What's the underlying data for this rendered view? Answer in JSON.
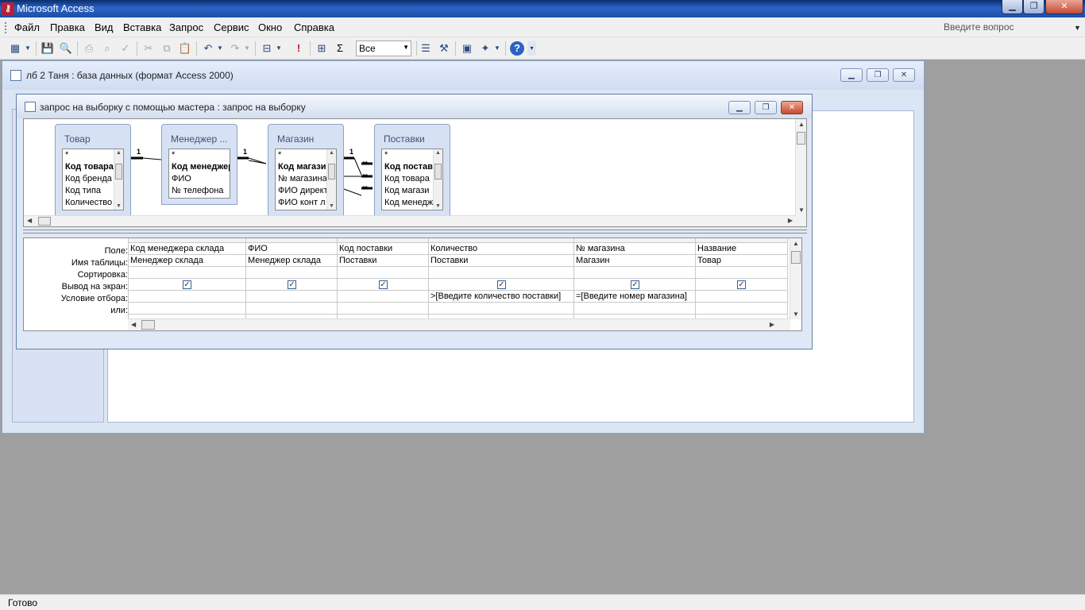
{
  "app": {
    "title": "Microsoft Access",
    "icon": "access-key-icon"
  },
  "menu": {
    "items": [
      "Файл",
      "Правка",
      "Вид",
      "Вставка",
      "Запрос",
      "Сервис",
      "Окно",
      "Справка"
    ],
    "ask_placeholder": "Введите вопрос"
  },
  "toolbar": {
    "top_values": "Все"
  },
  "db_window": {
    "title": "лб 2 Таня : база данных (формат Access 2000)"
  },
  "query_window": {
    "title": "запрос на выборку с помощью мастера : запрос на выборку"
  },
  "tables": [
    {
      "name": "Товар",
      "fields": [
        "*",
        "Код товара",
        "Код бренда",
        "Код типа",
        "Количество"
      ],
      "key_index": 1
    },
    {
      "name": "Менеджер ...",
      "fields": [
        "*",
        "Код менеджер",
        "ФИО",
        "№ телефона"
      ],
      "key_index": 1
    },
    {
      "name": "Магазин",
      "fields": [
        "*",
        "Код магазин",
        "№ магазина",
        "ФИО директ",
        "ФИО конт л"
      ],
      "key_index": 1
    },
    {
      "name": "Поставки",
      "fields": [
        "*",
        "Код постав",
        "Код товара",
        "Код магази",
        "Код менедж"
      ],
      "key_index": 1
    }
  ],
  "relations": {
    "one": "1",
    "many": "∞"
  },
  "grid": {
    "row_labels": [
      "Поле:",
      "Имя таблицы:",
      "Сортировка:",
      "Вывод на экран:",
      "Условие отбора:",
      "или:"
    ],
    "columns": [
      {
        "field": "Код менеджера склада",
        "table": "Менеджер склада",
        "sort": "",
        "show": true,
        "criteria": "",
        "or": ""
      },
      {
        "field": "ФИО",
        "table": "Менеджер склада",
        "sort": "",
        "show": true,
        "criteria": "",
        "or": ""
      },
      {
        "field": "Код поставки",
        "table": "Поставки",
        "sort": "",
        "show": true,
        "criteria": "",
        "or": ""
      },
      {
        "field": "Количество",
        "table": "Поставки",
        "sort": "",
        "show": true,
        "criteria": ">[Введите количество поставки]",
        "or": ""
      },
      {
        "field": "№ магазина",
        "table": "Магазин",
        "sort": "",
        "show": true,
        "criteria": "=[Введите номер магазина]",
        "or": ""
      },
      {
        "field": "Название",
        "table": "Товар",
        "sort": "",
        "show": true,
        "criteria": "",
        "or": ""
      }
    ]
  },
  "status": {
    "text": "Готово"
  }
}
